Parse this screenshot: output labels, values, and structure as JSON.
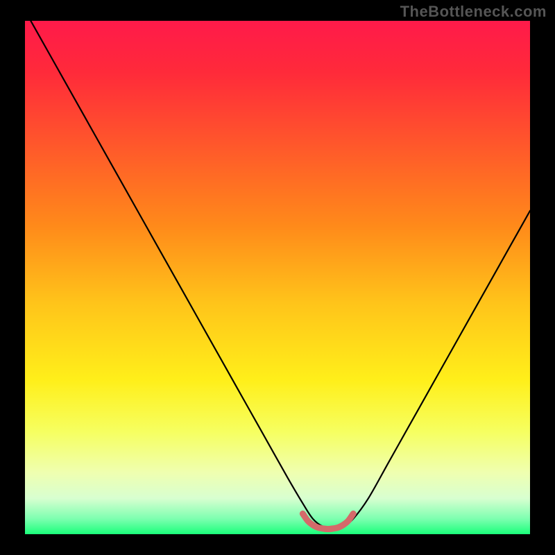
{
  "watermark": "TheBottleneck.com",
  "colors": {
    "frame": "#000000",
    "curve": "#000000",
    "bump": "#d46a6a",
    "gradient_stops": [
      {
        "offset": 0.0,
        "color": "#ff1a4a"
      },
      {
        "offset": 0.1,
        "color": "#ff2a3a"
      },
      {
        "offset": 0.25,
        "color": "#ff5a2a"
      },
      {
        "offset": 0.4,
        "color": "#ff8a1a"
      },
      {
        "offset": 0.55,
        "color": "#ffc41a"
      },
      {
        "offset": 0.7,
        "color": "#ffef1a"
      },
      {
        "offset": 0.8,
        "color": "#f6ff60"
      },
      {
        "offset": 0.88,
        "color": "#efffb0"
      },
      {
        "offset": 0.93,
        "color": "#d8ffd0"
      },
      {
        "offset": 0.97,
        "color": "#7dffb0"
      },
      {
        "offset": 1.0,
        "color": "#1aff7a"
      }
    ],
    "watermark": "#555555"
  },
  "chart_data": {
    "type": "line",
    "title": "",
    "xlabel": "",
    "ylabel": "",
    "xlim": [
      0,
      100
    ],
    "ylim": [
      0,
      100
    ],
    "grid": false,
    "legend": false,
    "series": [
      {
        "name": "bottleneck-curve",
        "x": [
          0,
          4,
          8,
          12,
          16,
          20,
          24,
          28,
          32,
          36,
          40,
          44,
          48,
          52,
          55,
          57,
          59,
          61,
          63,
          65,
          68,
          72,
          76,
          80,
          84,
          88,
          92,
          96,
          100
        ],
        "y": [
          102,
          95,
          88,
          81,
          74,
          67,
          60,
          53,
          46,
          39,
          32,
          25,
          18,
          11,
          6,
          3,
          1.5,
          1.2,
          1.5,
          3,
          7,
          14,
          21,
          28,
          35,
          42,
          49,
          56,
          63
        ]
      },
      {
        "name": "optimal-range-marker",
        "x": [
          55,
          56,
          57,
          58,
          59,
          60,
          61,
          62,
          63,
          64,
          65
        ],
        "y": [
          4.0,
          2.6,
          1.8,
          1.3,
          1.1,
          1.0,
          1.1,
          1.3,
          1.8,
          2.6,
          4.0
        ]
      }
    ]
  }
}
